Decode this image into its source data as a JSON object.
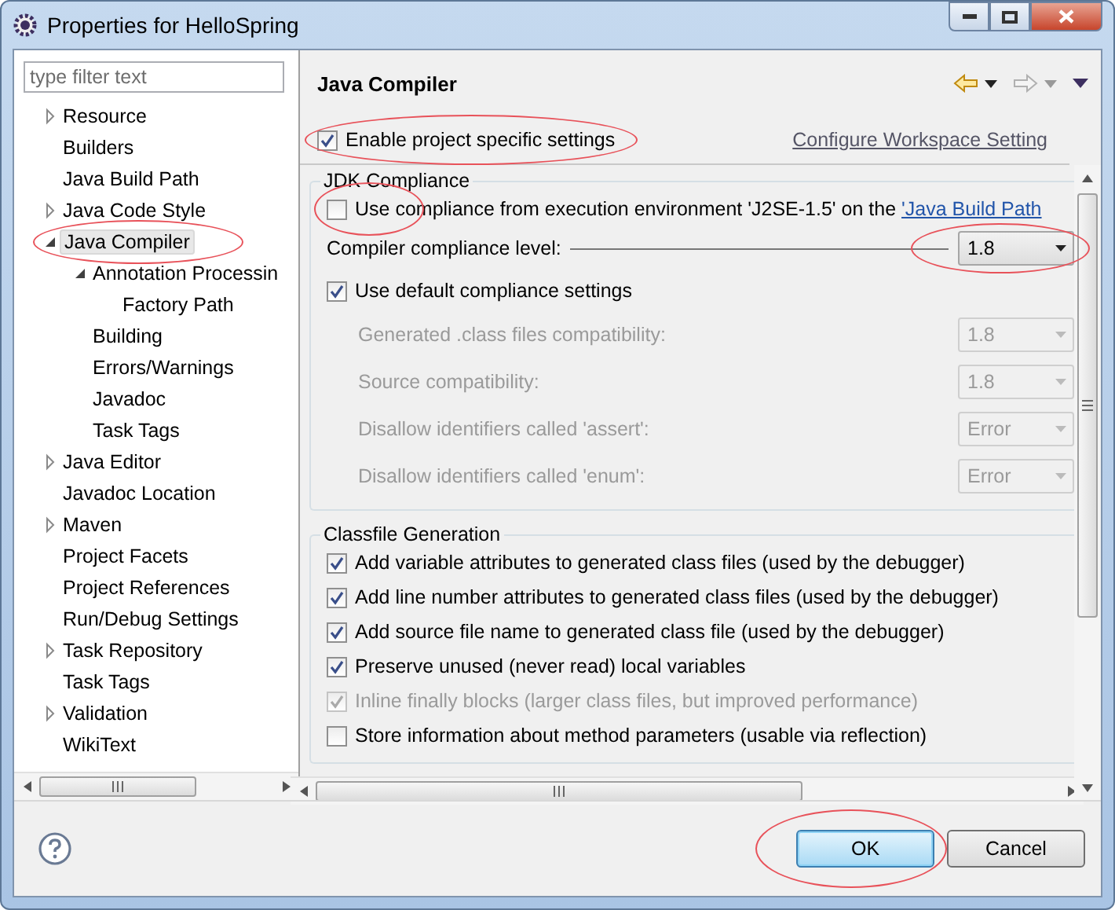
{
  "window": {
    "title": "Properties for HelloSpring"
  },
  "sidebar": {
    "filter": {
      "placeholder": "type filter text"
    },
    "tree": [
      {
        "label": "Resource",
        "expanded": false,
        "selected": false
      },
      {
        "label": "Builders",
        "selected": false
      },
      {
        "label": "Java Build Path",
        "selected": false
      },
      {
        "label": "Java Code Style",
        "expanded": false,
        "selected": false
      },
      {
        "label": "Java Compiler",
        "expanded": true,
        "selected": true,
        "circled": true,
        "children": [
          {
            "label": "Annotation Processin",
            "expanded": true,
            "selected": false,
            "children": [
              {
                "label": "Factory Path",
                "selected": false
              }
            ]
          },
          {
            "label": "Building",
            "selected": false
          },
          {
            "label": "Errors/Warnings",
            "selected": false
          },
          {
            "label": "Javadoc",
            "selected": false
          },
          {
            "label": "Task Tags",
            "selected": false
          }
        ]
      },
      {
        "label": "Java Editor",
        "expanded": false,
        "selected": false
      },
      {
        "label": "Javadoc Location",
        "selected": false
      },
      {
        "label": "Maven",
        "expanded": false,
        "selected": false
      },
      {
        "label": "Project Facets",
        "selected": false
      },
      {
        "label": "Project References",
        "selected": false
      },
      {
        "label": "Run/Debug Settings",
        "selected": false
      },
      {
        "label": "Task Repository",
        "expanded": false,
        "selected": false
      },
      {
        "label": "Task Tags",
        "selected": false
      },
      {
        "label": "Validation",
        "expanded": false,
        "selected": false
      },
      {
        "label": "WikiText",
        "selected": false
      }
    ]
  },
  "page": {
    "title": "Java Compiler",
    "enable": {
      "label": "Enable project specific settings",
      "checked": true,
      "circled": true
    },
    "configure_link": "Configure Workspace Setting",
    "jdk_group": {
      "title": "JDK Compliance",
      "use_compliance": {
        "label": "Use compliance from execution environment 'J2SE-1.5' on the ",
        "link": "'Java Build Path",
        "checked": false,
        "circled": true
      },
      "compliance_level": {
        "label": "Compiler compliance level:",
        "value": "1.8",
        "circled": true
      },
      "use_default": {
        "label": "Use default compliance settings",
        "checked": true
      },
      "settings": [
        {
          "label": "Generated .class files compatibility:",
          "value": "1.8",
          "disabled": true
        },
        {
          "label": "Source compatibility:",
          "value": "1.8",
          "disabled": true
        },
        {
          "label": "Disallow identifiers called 'assert':",
          "value": "Error",
          "disabled": true
        },
        {
          "label": "Disallow identifiers called 'enum':",
          "value": "Error",
          "disabled": true
        }
      ]
    },
    "classfile_group": {
      "title": "Classfile Generation",
      "options": [
        {
          "label": "Add variable attributes to generated class files (used by the debugger)",
          "checked": true,
          "disabled": false
        },
        {
          "label": "Add line number attributes to generated class files (used by the debugger)",
          "checked": true,
          "disabled": false
        },
        {
          "label": "Add source file name to generated class file (used by the debugger)",
          "checked": true,
          "disabled": false
        },
        {
          "label": "Preserve unused (never read) local variables",
          "checked": true,
          "disabled": false
        },
        {
          "label": "Inline finally blocks (larger class files, but improved performance)",
          "checked": true,
          "disabled": true
        },
        {
          "label": "Store information about method parameters (usable via reflection)",
          "checked": false,
          "disabled": false
        }
      ]
    }
  },
  "buttons": [
    {
      "label": "OK",
      "default": true,
      "circled": true
    },
    {
      "label": "Cancel",
      "default": false,
      "circled": false
    }
  ]
}
